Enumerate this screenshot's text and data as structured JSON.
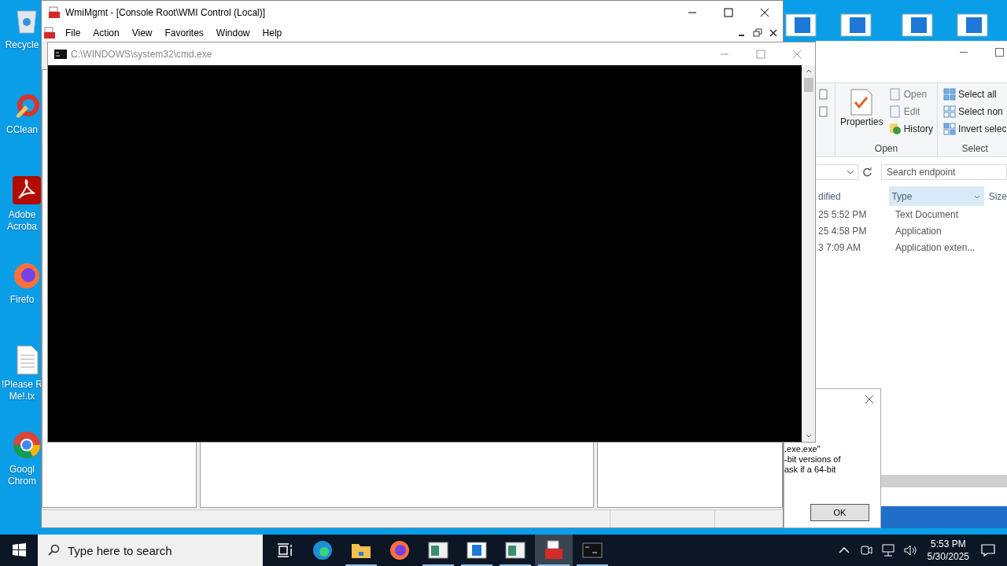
{
  "desktop": {
    "icons": [
      {
        "kind": "recycle",
        "lines": [
          "Recycle"
        ]
      },
      {
        "kind": "ccleaner",
        "lines": [
          "CClean"
        ]
      },
      {
        "kind": "acrobat",
        "lines": [
          "Adobe",
          "Acroba"
        ]
      },
      {
        "kind": "firefox",
        "lines": [
          "Firefo"
        ]
      },
      {
        "kind": "textfile",
        "lines": [
          "!Please R",
          "Me!.tx"
        ]
      },
      {
        "kind": "chrome",
        "lines": [
          "Googl",
          "Chrom"
        ]
      }
    ]
  },
  "wmimgmt": {
    "title": "WmiMgmt - [Console Root\\WMI Control (Local)]",
    "menu": [
      "File",
      "Action",
      "View",
      "Favorites",
      "Window",
      "Help"
    ]
  },
  "cmd": {
    "title": "C:\\WINDOWS\\system32\\cmd.exe"
  },
  "explorer": {
    "open_group": {
      "properties": "Properties",
      "label": "Open",
      "items": [
        {
          "kind": "open",
          "label": "Open",
          "disabled": true
        },
        {
          "kind": "edit",
          "label": "Edit",
          "disabled": true
        },
        {
          "kind": "history",
          "label": "History",
          "disabled": false
        }
      ]
    },
    "select_group": {
      "label": "Select",
      "items": [
        {
          "kind": "all",
          "label": "Select all"
        },
        {
          "kind": "none",
          "label": "Select non"
        },
        {
          "kind": "invert",
          "label": "Invert selec"
        }
      ]
    },
    "search": {
      "placeholder": "Search endpoint"
    },
    "columns": [
      {
        "label": "dified",
        "selected": false
      },
      {
        "label": "Type",
        "selected": true
      },
      {
        "label": "Size",
        "selected": false
      }
    ],
    "rows": [
      {
        "modified": "25 5:52 PM",
        "type": "Text Document"
      },
      {
        "modified": "25 4:58 PM",
        "type": "Application"
      },
      {
        "modified": "3 7:09 AM",
        "type": "Application exten..."
      }
    ]
  },
  "dialog": {
    "lines": [
      ".exe.exe\"",
      "-bit versions of",
      "ask if a 64-bit"
    ],
    "ok": "OK"
  },
  "taskbar": {
    "search": {
      "placeholder": "Type here to search"
    },
    "apps": [
      {
        "kind": "edge",
        "running": false,
        "selected": false
      },
      {
        "kind": "folder",
        "running": true,
        "selected": false
      },
      {
        "kind": "firefox",
        "running": false,
        "selected": false
      },
      {
        "kind": "window",
        "running": true,
        "selected": false
      },
      {
        "kind": "window2",
        "running": true,
        "selected": false
      },
      {
        "kind": "window",
        "running": true,
        "selected": false
      },
      {
        "kind": "toolbox",
        "running": true,
        "selected": true
      },
      {
        "kind": "console",
        "running": true,
        "selected": false
      }
    ],
    "clock": {
      "time": "5:53 PM",
      "date": "5/30/2025"
    }
  }
}
